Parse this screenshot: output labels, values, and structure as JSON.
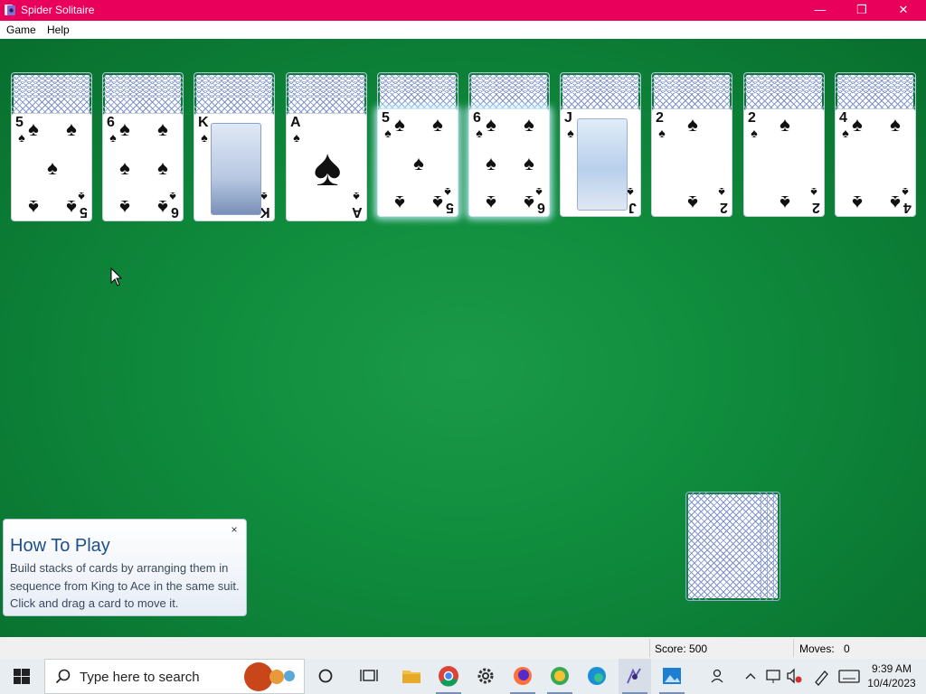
{
  "window": {
    "title": "Spider Solitaire",
    "minimize_glyph": "—",
    "restore_glyph": "❐",
    "close_glyph": "✕"
  },
  "menu": {
    "game": "Game",
    "help": "Help"
  },
  "tableau": [
    {
      "hidden": 6,
      "rank": "5",
      "suit": "♠",
      "highlight": false
    },
    {
      "hidden": 6,
      "rank": "6",
      "suit": "♠",
      "highlight": false
    },
    {
      "hidden": 6,
      "rank": "K",
      "suit": "♠",
      "highlight": false
    },
    {
      "hidden": 6,
      "rank": "A",
      "suit": "♠",
      "highlight": false
    },
    {
      "hidden": 5,
      "rank": "5",
      "suit": "♠",
      "highlight": true
    },
    {
      "hidden": 5,
      "rank": "6",
      "suit": "♠",
      "highlight": true
    },
    {
      "hidden": 5,
      "rank": "J",
      "suit": "♠",
      "highlight": false
    },
    {
      "hidden": 5,
      "rank": "2",
      "suit": "♠",
      "highlight": false
    },
    {
      "hidden": 5,
      "rank": "2",
      "suit": "♠",
      "highlight": false
    },
    {
      "hidden": 5,
      "rank": "4",
      "suit": "♠",
      "highlight": false
    }
  ],
  "stock": {
    "piles": 4
  },
  "tip": {
    "title": "How To Play",
    "body": "Build stacks of cards by arranging them in sequence from King to Ace in the same suit. Click and drag a card to move it.",
    "close_glyph": "×"
  },
  "status": {
    "score": "Score: 500",
    "moves_label": "Moves:",
    "moves_value": "0"
  },
  "taskbar": {
    "search_placeholder": "Type here to search",
    "time": "9:39 AM",
    "date": "10/4/2023"
  },
  "colors": {
    "title_bar": "#e8005a",
    "felt": "#0f8a3c",
    "taskbar": "#e8edf2"
  }
}
